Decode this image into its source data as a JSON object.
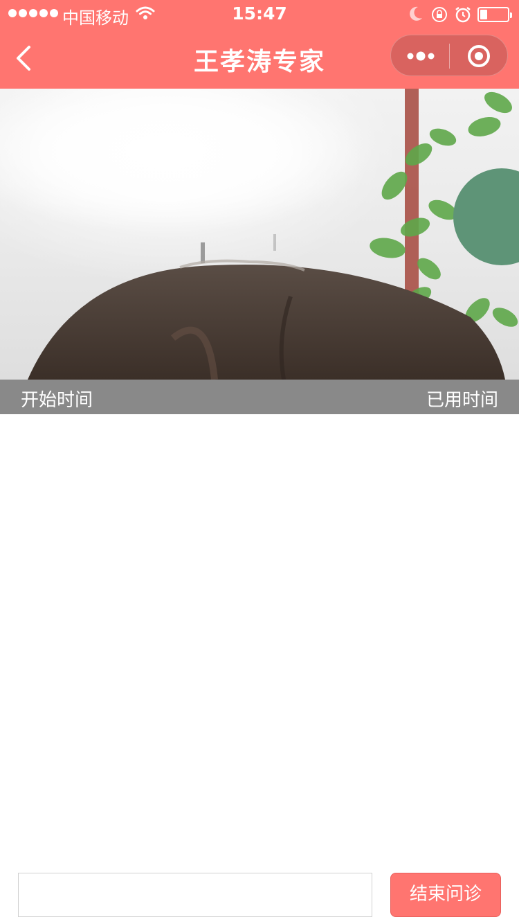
{
  "status_bar": {
    "carrier": "中国移动",
    "time": "15:47",
    "battery_level": 0.25
  },
  "nav": {
    "title": "王孝涛专家"
  },
  "video": {
    "start_time_label": "开始时间",
    "elapsed_time_label": "已用时间"
  },
  "footer": {
    "input_value": "",
    "input_placeholder": "",
    "end_button_label": "结束问诊"
  },
  "colors": {
    "accent": "#ff7570",
    "time_bar": "#898989"
  },
  "icons": [
    "signal-icon",
    "wifi-icon",
    "moon-icon",
    "orientation-lock-icon",
    "alarm-icon",
    "battery-icon",
    "back-arrow-icon",
    "more-dots-icon",
    "close-circle-icon"
  ]
}
